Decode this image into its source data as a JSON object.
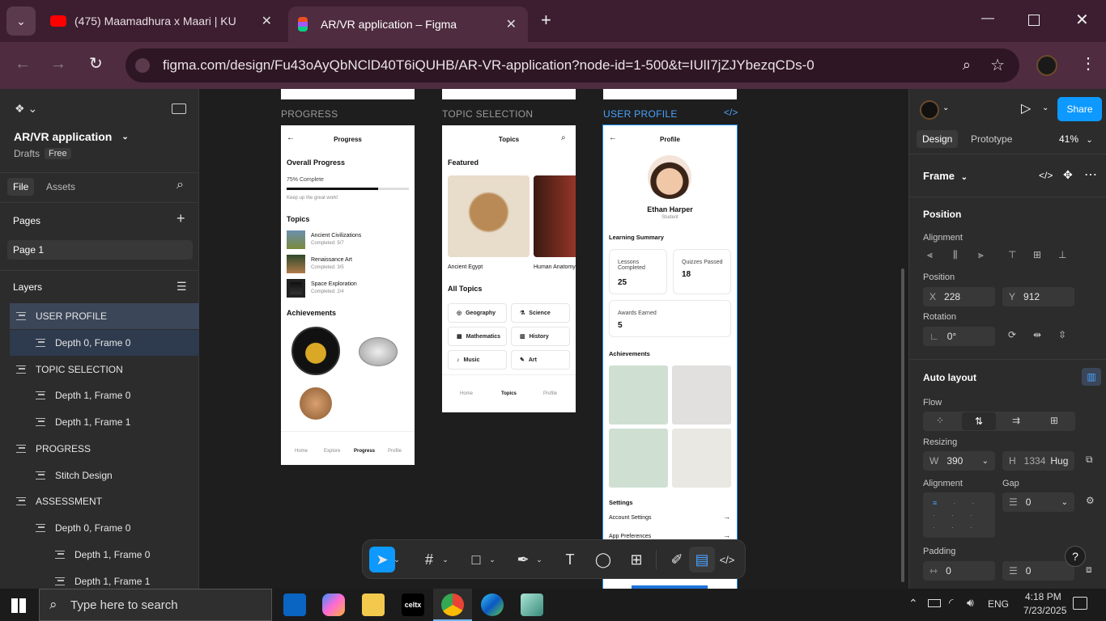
{
  "browser": {
    "tabs": [
      {
        "title": "(475) Maamadhura x Maari | KU"
      },
      {
        "title": "AR/VR application – Figma"
      }
    ],
    "url": "figma.com/design/Fu43oAyQbNClD40T6iQUHB/AR-VR-application?node-id=1-500&t=IUlI7jZJYbezqCDs-0"
  },
  "figma": {
    "file_name": "AR/VR application",
    "location": "Drafts",
    "plan": "Free",
    "tabs": {
      "file": "File",
      "assets": "Assets"
    },
    "pages_title": "Pages",
    "page": "Page 1",
    "layers_title": "Layers",
    "layers": [
      {
        "name": "USER PROFILE"
      },
      {
        "name": "Depth 0, Frame 0"
      },
      {
        "name": "TOPIC SELECTION"
      },
      {
        "name": "Depth 1, Frame 0"
      },
      {
        "name": "Depth 1, Frame 1"
      },
      {
        "name": "PROGRESS"
      },
      {
        "name": "Stitch Design"
      },
      {
        "name": "ASSESSMENT"
      },
      {
        "name": "Depth 0, Frame 0"
      },
      {
        "name": "Depth 1, Frame 0"
      },
      {
        "name": "Depth 1, Frame 1"
      }
    ],
    "right": {
      "share": "Share",
      "tab_design": "Design",
      "tab_prototype": "Prototype",
      "zoom": "41%",
      "frame_label": "Frame",
      "position_title": "Position",
      "alignment_label": "Alignment",
      "position_label": "Position",
      "x_key": "X",
      "x_val": "228",
      "y_key": "Y",
      "y_val": "912",
      "rotation_label": "Rotation",
      "rotation_val": "0°",
      "autolayout_title": "Auto layout",
      "flow_label": "Flow",
      "resizing_label": "Resizing",
      "w_key": "W",
      "w_val": "390",
      "h_key": "H",
      "h_val": "1334",
      "h_mode": "Hug",
      "align_label": "Alignment",
      "gap_label": "Gap",
      "gap_val": "0",
      "padding_label": "Padding",
      "pad_h": "0",
      "pad_v": "0"
    }
  },
  "canvas": {
    "progress": {
      "label": "PROGRESS",
      "title": "Progress",
      "overall": "Overall Progress",
      "percent_text": "75% Complete",
      "percent": 0.75,
      "encourage": "Keep up the great work!",
      "topics_title": "Topics",
      "topics": [
        {
          "name": "Ancient Civilizations",
          "status": "Completed: 5/7"
        },
        {
          "name": "Renaissance Art",
          "status": "Completed: 3/5"
        },
        {
          "name": "Space Exploration",
          "status": "Completed: 2/4"
        }
      ],
      "achievements": "Achievements",
      "nav": [
        "Home",
        "Explore",
        "Progress",
        "Profile"
      ]
    },
    "topics": {
      "label": "TOPIC SELECTION",
      "title": "Topics",
      "featured": "Featured",
      "featured_items": [
        "Ancient Egypt",
        "Human Anatomy"
      ],
      "all_topics": "All Topics",
      "grid": [
        "Geography",
        "Science",
        "Mathematics",
        "History",
        "Music",
        "Art"
      ],
      "nav": [
        "Home",
        "Topics",
        "Profile"
      ]
    },
    "profile": {
      "label": "USER PROFILE",
      "title": "Profile",
      "name": "Ethan Harper",
      "role": "Student",
      "summary": "Learning Summary",
      "lessons_label": "Lessons Completed",
      "lessons": "25",
      "quizzes_label": "Quizzes Passed",
      "quizzes": "18",
      "awards_label": "Awards Earned",
      "awards": "5",
      "achievements": "Achievements",
      "settings": "Settings",
      "account": "Account Settings",
      "app_prefs": "App Preferences"
    }
  },
  "taskbar": {
    "search_placeholder": "Type here to search",
    "lang": "ENG",
    "time": "4:18 PM",
    "date": "7/23/2025"
  }
}
